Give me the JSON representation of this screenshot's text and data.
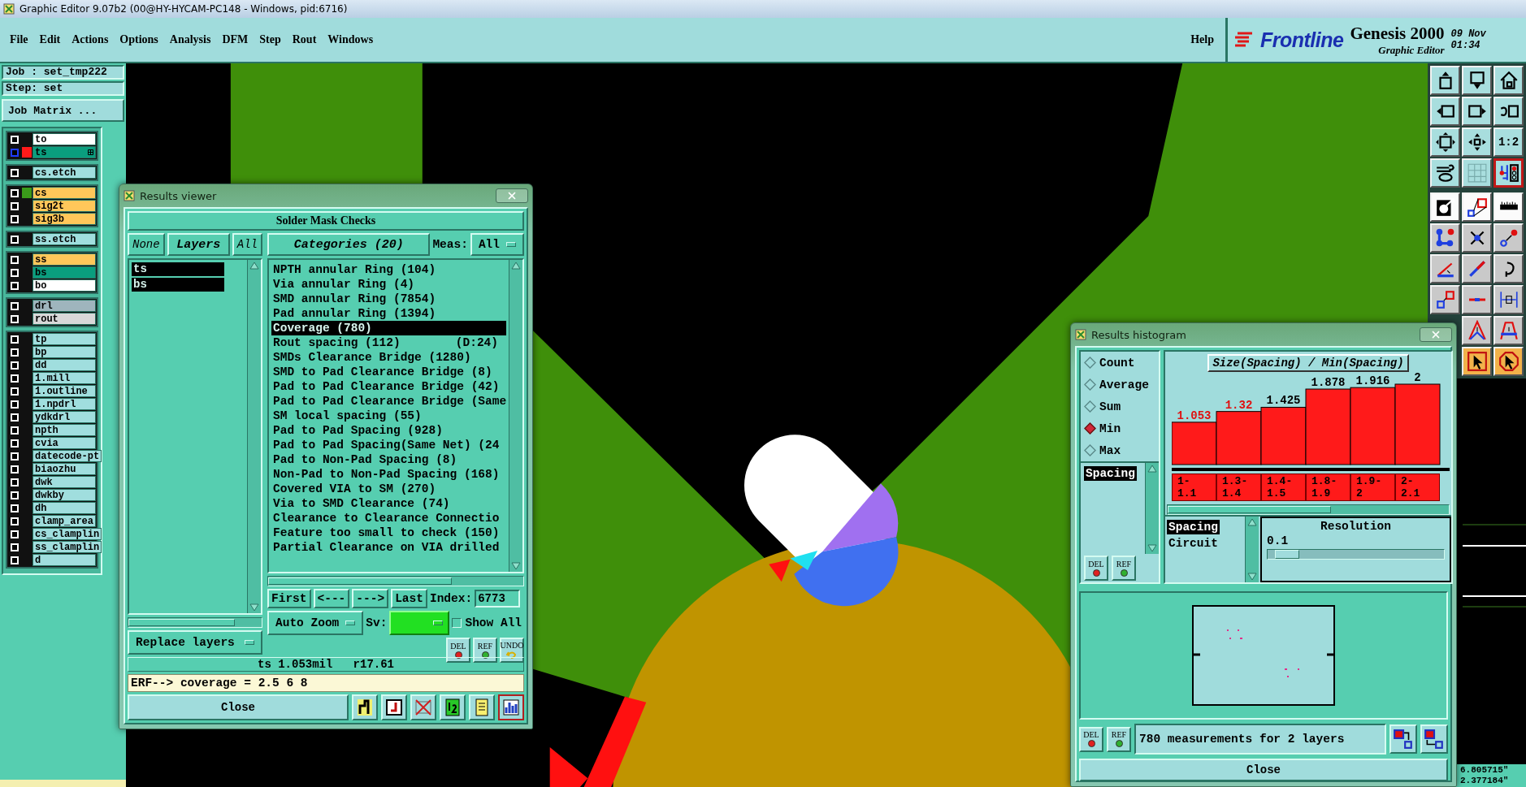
{
  "window": {
    "title": "Graphic Editor 9.07b2 (00@HY-HYCAM-PC148 - Windows, pid:6716)"
  },
  "menu": [
    "File",
    "Edit",
    "Actions",
    "Options",
    "Analysis",
    "DFM",
    "Step",
    "Rout",
    "Windows"
  ],
  "help": "Help",
  "brand": {
    "logo": "Frontline",
    "product": "Genesis 2000",
    "subtitle": "Graphic Editor",
    "date": "09 Nov",
    "time": "01:34"
  },
  "job": {
    "job": "Job : set_tmp222",
    "step": "Step: set",
    "matrix_button": "Job Matrix ..."
  },
  "layer_groups": [
    [
      {
        "name": "to",
        "color": "#ffffff",
        "active": false
      },
      {
        "name": "ts",
        "color": "#0a9e7e",
        "swatch": {
          "color": "#ff1a1a"
        },
        "active": true
      }
    ],
    [
      {
        "name": "cs.etch",
        "color": "#a0dede",
        "active": false
      }
    ],
    [
      {
        "name": "cs",
        "color": "#ffc75a",
        "swatch": {
          "color": "#3a9a1a"
        },
        "active": false
      },
      {
        "name": "sig2t",
        "color": "#ffc75a",
        "active": false
      },
      {
        "name": "sig3b",
        "color": "#ffc75a",
        "active": false
      }
    ],
    [
      {
        "name": "ss.etch",
        "color": "#a0dede",
        "active": false
      }
    ],
    [
      {
        "name": "ss",
        "color": "#ffc75a",
        "active": false
      },
      {
        "name": "bs",
        "color": "#0a9e7e",
        "active": false
      },
      {
        "name": "bo",
        "color": "#ffffff",
        "active": false
      }
    ],
    [
      {
        "name": "drl",
        "color": "#9fb5bd",
        "active": false
      },
      {
        "name": "rout",
        "color": "#d8d8d8",
        "active": false
      }
    ],
    [
      {
        "name": "tp",
        "color": "#a0dede",
        "active": false
      },
      {
        "name": "bp",
        "color": "#a0dede",
        "active": false
      },
      {
        "name": "dd",
        "color": "#a0dede",
        "active": false
      },
      {
        "name": "1.mill",
        "color": "#a0dede",
        "active": false
      },
      {
        "name": "1.outline",
        "color": "#a0dede",
        "active": false
      },
      {
        "name": "1.npdrl",
        "color": "#a0dede",
        "active": false
      },
      {
        "name": "ydkdrl",
        "color": "#a0dede",
        "active": false
      },
      {
        "name": "npth",
        "color": "#a0dede",
        "active": false
      },
      {
        "name": "cvia",
        "color": "#a0dede",
        "active": false
      },
      {
        "name": "datecode-pt",
        "color": "#a0dede",
        "active": false
      },
      {
        "name": "biaozhu",
        "color": "#a0dede",
        "active": false
      },
      {
        "name": "dwk",
        "color": "#a0dede",
        "active": false
      },
      {
        "name": "dwkby",
        "color": "#a0dede",
        "active": false
      },
      {
        "name": "dh",
        "color": "#a0dede",
        "active": false
      },
      {
        "name": "clamp_area",
        "color": "#a0dede",
        "active": false
      },
      {
        "name": "cs_clamplin",
        "color": "#a0dede",
        "active": false
      },
      {
        "name": "ss_clamplin",
        "color": "#a0dede",
        "active": false
      },
      {
        "name": "d",
        "color": "#a0dede",
        "active": false
      }
    ]
  ],
  "results_viewer": {
    "title": "Results viewer",
    "header": "Solder Mask Checks",
    "layer_buttons": [
      "None",
      "Layers",
      "All"
    ],
    "categories_button": "Categories (20)",
    "meas_label": "Meas:",
    "meas_value": "All",
    "layers": [
      {
        "name": "ts",
        "selected": true
      },
      {
        "name": "bs",
        "selected": true
      }
    ],
    "categories": [
      {
        "label": "NPTH annular Ring (104)",
        "selected": false
      },
      {
        "label": "Via annular Ring (4)",
        "selected": false
      },
      {
        "label": "SMD annular Ring (7854)",
        "selected": false
      },
      {
        "label": "Pad annular Ring (1394)",
        "selected": false
      },
      {
        "label": "Coverage (780)",
        "selected": true
      },
      {
        "label": "Rout spacing (112)",
        "detail": "(D:24)",
        "selected": false
      },
      {
        "label": "SMDs Clearance Bridge (1280)",
        "selected": false
      },
      {
        "label": "SMD to Pad Clearance Bridge (8)",
        "selected": false
      },
      {
        "label": "Pad to Pad Clearance Bridge (42)",
        "selected": false
      },
      {
        "label": "Pad to Pad Clearance Bridge (Same",
        "selected": false
      },
      {
        "label": "SM local spacing (55)",
        "selected": false
      },
      {
        "label": "Pad to Pad Spacing (928)",
        "selected": false
      },
      {
        "label": "Pad to Pad Spacing(Same Net) (24",
        "selected": false
      },
      {
        "label": "Pad to Non-Pad Spacing (8)",
        "selected": false
      },
      {
        "label": "Non-Pad to Non-Pad Spacing (168)",
        "selected": false
      },
      {
        "label": "Covered VIA to SM (270)",
        "selected": false
      },
      {
        "label": "Via to SMD Clearance (74)",
        "selected": false
      },
      {
        "label": "Clearance to Clearance Connectio",
        "selected": false
      },
      {
        "label": "Feature too small to check (150)",
        "selected": false
      },
      {
        "label": "Partial Clearance on VIA drilled",
        "selected": false
      }
    ],
    "nav": [
      "First",
      "<---",
      "--->",
      "Last"
    ],
    "index_label": "Index:",
    "index_value": "6773",
    "zoom_mode": "Auto Zoom",
    "sv_label": "Sv:",
    "show_all": {
      "label": "Show All",
      "checked": false
    },
    "replace_mode": "Replace layers",
    "small_buttons": [
      {
        "kind": "del",
        "label": "DEL"
      },
      {
        "kind": "ref",
        "label": "REF"
      },
      {
        "kind": "undo",
        "label": "UNDO"
      }
    ],
    "status": "ts 1.053mil   r17.61",
    "erf": "ERF--> coverage = 2.5 6 8",
    "close": "Close",
    "tools": [
      {
        "selected": false
      },
      {
        "selected": false
      },
      {
        "selected": false
      },
      {
        "selected": false
      },
      {
        "selected": false
      },
      {
        "selected": true
      }
    ]
  },
  "histogram": {
    "title": "Results histogram",
    "modes": [
      {
        "label": "Count",
        "selected": false
      },
      {
        "label": "Average",
        "selected": false
      },
      {
        "label": "Sum",
        "selected": false
      },
      {
        "label": "Min",
        "selected": true
      },
      {
        "label": "Max",
        "selected": false
      }
    ],
    "attributes": [
      {
        "label": "Spacing",
        "selected": true
      }
    ],
    "side_buttons": [
      {
        "kind": "del",
        "label": "DEL"
      },
      {
        "kind": "ref",
        "label": "REF"
      }
    ],
    "chart_data": {
      "type": "bar",
      "title": "Size(Spacing) / Min(Spacing)",
      "categories": [
        "1-1.1",
        "1.3-1.4",
        "1.4-1.5",
        "1.8-1.9",
        "1.9-2",
        "2-2.1"
      ],
      "series": [
        {
          "color": "#ff1a1a",
          "values": [
            1.053,
            1.32,
            1.425,
            1.878,
            1.916,
            2
          ]
        }
      ],
      "data_labels": true
    },
    "value_label_flags": [
      {
        "flagged": true
      },
      {
        "flagged": true
      },
      {
        "flagged": false
      },
      {
        "flagged": false
      },
      {
        "flagged": false
      },
      {
        "flagged": false
      }
    ],
    "fields": [
      {
        "label": "Spacing",
        "selected": true
      },
      {
        "label": "Circuit",
        "selected": false
      }
    ],
    "resolution": {
      "label": "Resolution",
      "value": "0.1",
      "level": 0.05
    },
    "bottom_buttons": [
      {
        "kind": "del",
        "label": "DEL"
      },
      {
        "kind": "ref",
        "label": "REF"
      }
    ],
    "summary": "780 measurements for 2 layers",
    "close": "Close"
  },
  "toolbar": [
    [
      {
        "selected": false
      },
      {
        "selected": false
      },
      {
        "selected": false
      }
    ],
    [
      {
        "selected": false
      },
      {
        "selected": false
      },
      {
        "selected": false
      }
    ],
    [
      {
        "selected": false
      },
      {
        "selected": false
      },
      {
        "selected": false,
        "label": "1:2"
      }
    ],
    [
      {
        "selected": false
      },
      {
        "selected": false
      },
      {
        "selected": true
      }
    ],
    [
      {
        "selected": false
      },
      {
        "selected": false
      },
      {
        "selected": false
      }
    ],
    [
      {
        "selected": false
      },
      {
        "selected": false
      },
      {
        "selected": false
      }
    ],
    [
      {
        "selected": false
      },
      {
        "selected": false
      },
      {
        "selected": false
      }
    ],
    [
      {
        "selected": false
      },
      {
        "selected": false
      },
      {
        "selected": false
      }
    ],
    [
      {
        "selected": false
      },
      {
        "selected": false
      }
    ],
    [
      {
        "selected": false
      },
      {
        "selected": false
      }
    ]
  ],
  "coords": [
    "6.805715\"",
    "2.377184\""
  ]
}
